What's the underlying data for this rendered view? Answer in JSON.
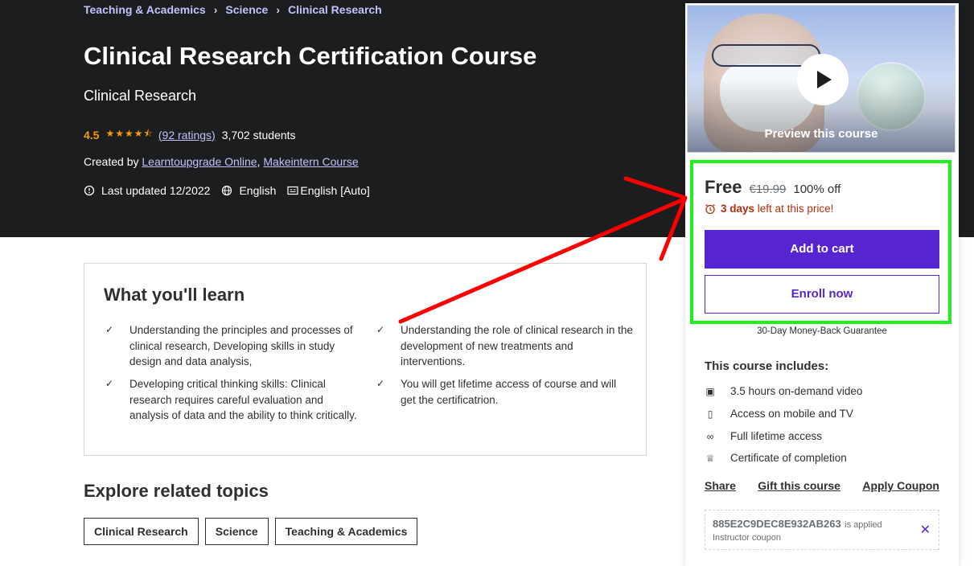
{
  "breadcrumbs": [
    "Teaching & Academics",
    "Science",
    "Clinical Research"
  ],
  "course": {
    "title": "Clinical Research Certification Course",
    "subtitle": "Clinical Research",
    "rating": "4.5",
    "ratings_link": "(92 ratings)",
    "students": "3,702 students",
    "created_by_prefix": "Created by",
    "authors": [
      "Learntoupgrade Online",
      "Makeintern Course"
    ],
    "last_updated": "Last updated 12/2022",
    "language": "English",
    "captions": "English [Auto]"
  },
  "learn": {
    "title": "What you'll learn",
    "items": [
      "Understanding the principles and processes of clinical research, Developing skills in study design and data analysis,",
      "Understanding the role of clinical research in the development of new treatments and interventions.",
      "Developing critical thinking skills: Clinical research requires careful evaluation and analysis of data and the ability to think critically.",
      "You will get lifetime access of course and will get the certificatrion."
    ]
  },
  "explore": {
    "title": "Explore related topics",
    "topics": [
      "Clinical Research",
      "Science",
      "Teaching & Academics"
    ]
  },
  "sidebar": {
    "preview_label": "Preview this course",
    "price": "Free",
    "original_price": "€19.99",
    "discount": "100% off",
    "timer_bold": "3 days",
    "timer_rest": "left at this price!",
    "add_to_cart": "Add to cart",
    "enroll_now": "Enroll now",
    "guarantee": "30-Day Money-Back Guarantee",
    "includes_title": "This course includes:",
    "includes": [
      {
        "icon": "video-icon",
        "label": "3.5 hours on-demand video"
      },
      {
        "icon": "mobile-icon",
        "label": "Access on mobile and TV"
      },
      {
        "icon": "infinity-icon",
        "label": "Full lifetime access"
      },
      {
        "icon": "trophy-icon",
        "label": "Certificate of completion"
      }
    ],
    "links": [
      "Share",
      "Gift this course",
      "Apply Coupon"
    ],
    "coupon": {
      "code": "885E2C9DEC8E932AB263",
      "applied_text": "is applied",
      "type": "Instructor coupon"
    }
  },
  "colors": {
    "hero_bg": "#1c1d1f",
    "accent_purple": "#5624d0",
    "link_lavender": "#c0c4fc",
    "star_orange": "#f69c08",
    "timer_red": "#b32d0f",
    "annotation_red": "#ff0000",
    "annotation_green": "#1ef01e"
  }
}
